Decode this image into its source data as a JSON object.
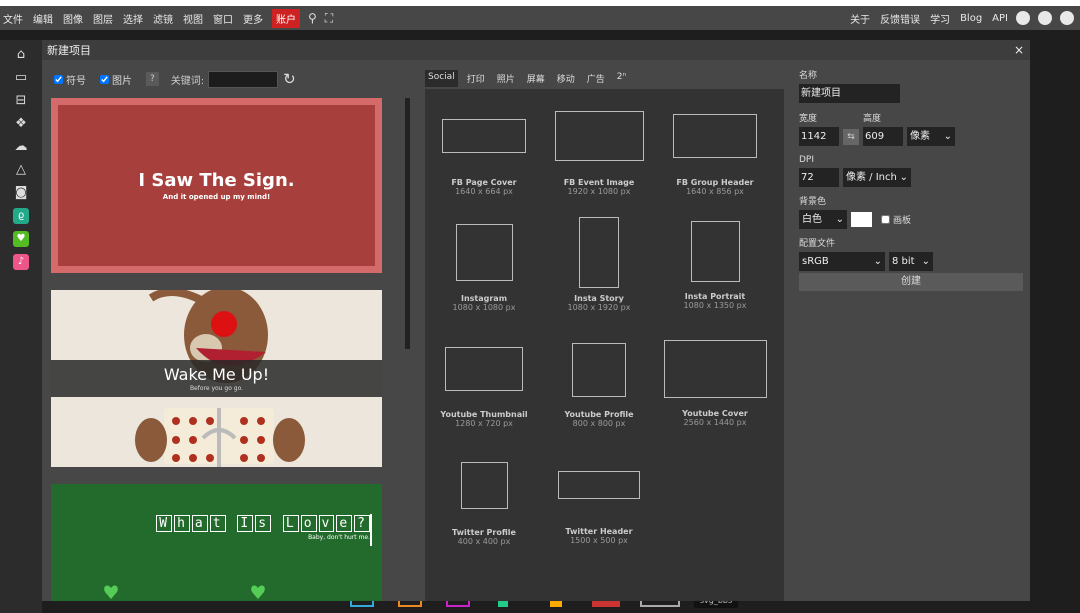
{
  "menubar": {
    "items": [
      "文件",
      "编辑",
      "图像",
      "图层",
      "选择",
      "滤镜",
      "视图",
      "窗口",
      "更多"
    ],
    "account": "账户",
    "right_links": [
      "关于",
      "反馈错误",
      "学习",
      "Blog",
      "API"
    ]
  },
  "dialog": {
    "title": "新建项目",
    "close": "×"
  },
  "templates": {
    "filter_symbol": "符号",
    "filter_picture": "图片",
    "help": "?",
    "keyword_label": "关键词:",
    "keyword_value": "",
    "cards": [
      {
        "title": "I Saw The Sign.",
        "subtitle": "And it opened up my mind!"
      },
      {
        "title": "Wake Me Up!",
        "subtitle": "Before you go go."
      },
      {
        "title_letters": [
          "W",
          "h",
          "a",
          "t",
          "I",
          "s",
          "L",
          "o",
          "v",
          "e",
          "?"
        ],
        "subtitle": "Baby, don't hurt me."
      }
    ]
  },
  "tabs": [
    "Social",
    "打印",
    "照片",
    "屏幕",
    "移动",
    "广告",
    "2ⁿ"
  ],
  "active_tab": "Social",
  "presets": [
    {
      "name": "FB Page Cover",
      "size": "1640 x 664 px"
    },
    {
      "name": "FB Event Image",
      "size": "1920 x 1080 px"
    },
    {
      "name": "FB Group Header",
      "size": "1640 x 856 px"
    },
    {
      "name": "Instagram",
      "size": "1080 x 1080 px"
    },
    {
      "name": "Insta Story",
      "size": "1080 x 1920 px"
    },
    {
      "name": "Insta Portrait",
      "size": "1080 x 1350 px"
    },
    {
      "name": "Youtube Thumbnail",
      "size": "1280 x 720 px"
    },
    {
      "name": "Youtube Profile",
      "size": "800 x 800 px"
    },
    {
      "name": "Youtube Cover",
      "size": "2560 x 1440 px"
    },
    {
      "name": "Twitter Profile",
      "size": "400 x 400 px"
    },
    {
      "name": "Twitter Header",
      "size": "1500 x 500 px"
    }
  ],
  "form": {
    "name_label": "名称",
    "name_value": "新建项目",
    "width_label": "宽度",
    "width_value": "1142",
    "height_label": "高度",
    "height_value": "609",
    "unit_value": "像素",
    "dpi_label": "DPI",
    "dpi_value": "72",
    "dpi_unit": "像素 / Inch",
    "bg_label": "背景色",
    "bg_value": "白色",
    "bg_color": "#ffffff",
    "canvas_label": "画板",
    "profile_label": "配置文件",
    "profile_value": "sRGB",
    "depth_value": "8 bit",
    "create_label": "创建"
  },
  "bottom": {
    "svg_label": "svg_bbs"
  },
  "colors": {
    "account": "#cc2222",
    "dialog_bg": "#474747",
    "panel_bg": "#333333"
  }
}
